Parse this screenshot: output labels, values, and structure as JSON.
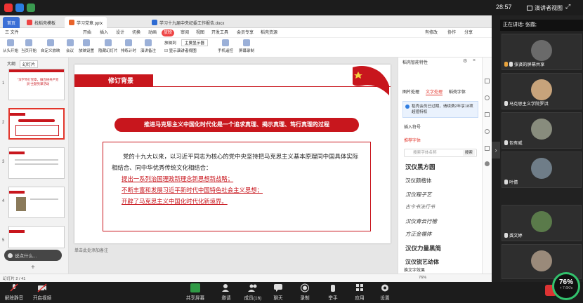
{
  "topbar": {
    "clock": "28:57",
    "view_label": "演讲者视图"
  },
  "wps": {
    "tabs": [
      {
        "label": "首页"
      },
      {
        "label": "找稻壳模板"
      },
      {
        "label": "学习党章.pptx"
      },
      {
        "label": "学习十九届中央纪委工作报告.docx"
      }
    ],
    "menu": [
      "三 文件",
      "开始",
      "插入",
      "设计",
      "切换",
      "动画",
      "放映",
      "审阅",
      "视图",
      "开发工具",
      "会员专享",
      "稻壳资源"
    ],
    "menu_right": [
      "有修改",
      "协作",
      "分享"
    ],
    "ribbon": [
      "从头开始",
      "当页开始",
      "自定义放映",
      "会议",
      "放映设置",
      "隐藏幻灯片",
      "排练计时",
      "演讲备注",
      "放映到",
      "主要显示器",
      "显示演讲者视图",
      "手机遥控",
      "屏幕录制"
    ],
    "thumb_tabs": [
      "大纲",
      "幻灯片"
    ],
    "thumb_numbers": [
      "1",
      "2",
      "3",
      "4",
      "5"
    ],
    "thumb1_title": "\"深学笃行党章，做合格共产党员\"主题党课活动",
    "speak_bubble": "说点什么...",
    "slide": {
      "head": "修订背景",
      "banner": "推进马克思主义中国化时代化是一个追求真理、揭示真理、笃行真理的过程",
      "para": "党的十九大以来，以习近平同志为核心的党中央坚持把马克思主义基本原理同中国具体实际相结合、同中华优秀传统文化相结合：",
      "red1": "提出一系列治国理政新理念新思想新战略；",
      "red2": "不断丰富和发展习近平新时代中国特色社会主义思想；",
      "red3": "开辟了马克思主义中国化时代化新境界。"
    },
    "notes": "单击此处添加备注",
    "status": "幻灯片 2 / 41",
    "status_right": "76%",
    "pane": {
      "title": "稻壳智能特性",
      "tabs": [
        "图片处理",
        "文字处理",
        "稻壳字体"
      ],
      "notice": "稻壳会员已过期，请续费2年享18项超值特权",
      "sec1": "插入符号",
      "sec2": "推荐字体",
      "search_placeholder": "搜索字体名称",
      "search_btn": "搜索",
      "samples": [
        "汉仪黑方圆",
        "汉仪颜楷体",
        "汉仪程子艺",
        "古今书法行书",
        "汉仪青云行楷",
        "方正金福体",
        "汉仪力量黑简",
        "汉仪锐艺幼体"
      ],
      "sec3": "换文字效果"
    }
  },
  "people": {
    "speaking": "正在讲话: 张霞;",
    "tiles": [
      {
        "name": "张贤的屏幕共享",
        "avatar": "#6a6a6a"
      },
      {
        "name": "马克思主义学院罗洪",
        "avatar": "#c7a37b"
      },
      {
        "name": "包有威",
        "avatar": "#888c7d"
      },
      {
        "name": "叶倩",
        "avatar": "#6f7d88"
      },
      {
        "name": "龚文婷",
        "avatar": "#5a7a4a"
      },
      {
        "name": "",
        "avatar": "#9a8a7a"
      }
    ]
  },
  "bottombar": {
    "buttons": [
      "解除静音",
      "开启视频",
      "共享屏幕",
      "邀请",
      "成员(16)",
      "聊天",
      "录制",
      "举手",
      "应用",
      "设置"
    ],
    "net_pct": "76%",
    "net_speed": "+ 7.6K/s"
  },
  "colors": {
    "party_red": "#c8161d",
    "wps_red": "#e2352b",
    "net_green": "#32c26d"
  }
}
